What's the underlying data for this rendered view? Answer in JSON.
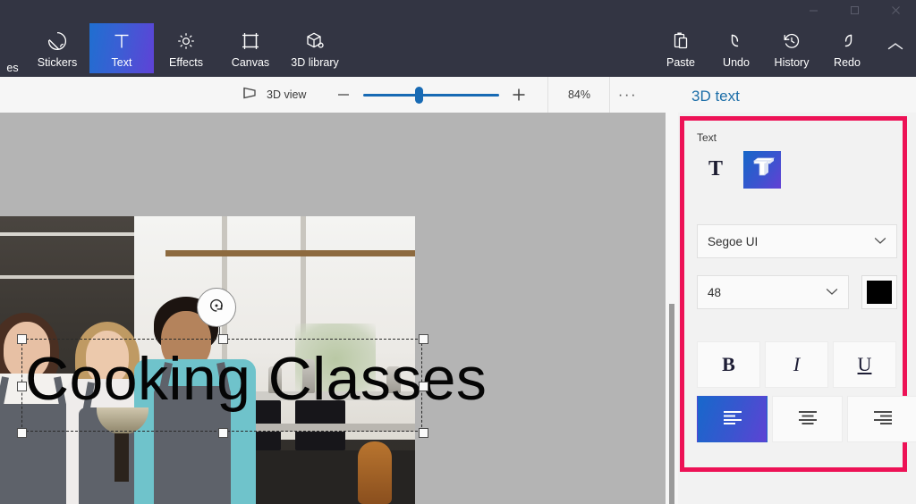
{
  "window": {
    "controls": [
      {
        "name": "minimize-button",
        "glyph": "minimize"
      },
      {
        "name": "maximize-button",
        "glyph": "maximize"
      },
      {
        "name": "close-button",
        "glyph": "close"
      }
    ]
  },
  "ribbon": {
    "tabs": [
      {
        "label": "es",
        "icon": "shapes-icon",
        "active": false,
        "clipped": true
      },
      {
        "label": "Stickers",
        "icon": "stickers-icon",
        "active": false
      },
      {
        "label": "Text",
        "icon": "text-icon",
        "active": true
      },
      {
        "label": "Effects",
        "icon": "effects-icon",
        "active": false
      },
      {
        "label": "Canvas",
        "icon": "canvas-icon",
        "active": false
      },
      {
        "label": "3D library",
        "icon": "3d-library-icon",
        "active": false
      }
    ],
    "right_tools": [
      {
        "label": "Paste",
        "icon": "paste-icon"
      },
      {
        "label": "Undo",
        "icon": "undo-icon"
      },
      {
        "label": "History",
        "icon": "history-icon"
      },
      {
        "label": "Redo",
        "icon": "redo-icon"
      }
    ],
    "collapse_icon": "chevron-up-icon",
    "active_tab_gradient": "#1f6fd0"
  },
  "subbar": {
    "view_mode_label": "3D view",
    "view_mode_icon": "perspective-icon",
    "zoom_out_label": "—",
    "zoom_in_label": "+",
    "zoom_percent": "84%",
    "more_label": "···",
    "slider_value": 38,
    "accent": "#176ab4"
  },
  "canvas": {
    "background": "#b4b4b4",
    "text_object": {
      "value": "Cooking Classes",
      "rotate_handle_icon": "rotate-icon"
    }
  },
  "panel": {
    "title": "3D text",
    "title_color": "#1c6ea8",
    "highlight_color": "#ed1256",
    "section_label": "Text",
    "type_buttons": [
      {
        "name": "text-type-2d-button",
        "icon": "2d-text-icon",
        "selected": false
      },
      {
        "name": "text-type-3d-button",
        "icon": "3d-text-icon",
        "selected": true
      }
    ],
    "font": {
      "value": "Segoe UI",
      "chevron_icon": "chevron-down-icon"
    },
    "size": {
      "value": "48",
      "chevron_icon": "chevron-down-icon"
    },
    "color": {
      "value": "#000000",
      "name": "text-color-swatch"
    },
    "styles": [
      {
        "name": "bold-button",
        "label": "B",
        "kind": "b"
      },
      {
        "name": "italic-button",
        "label": "I",
        "kind": "i"
      },
      {
        "name": "underline-button",
        "label": "U",
        "kind": "u"
      }
    ],
    "alignment": [
      {
        "name": "align-left-button",
        "icon": "align-left-icon",
        "selected": true
      },
      {
        "name": "align-center-button",
        "icon": "align-center-icon",
        "selected": false
      },
      {
        "name": "align-right-button",
        "icon": "align-right-icon",
        "selected": false
      }
    ]
  }
}
